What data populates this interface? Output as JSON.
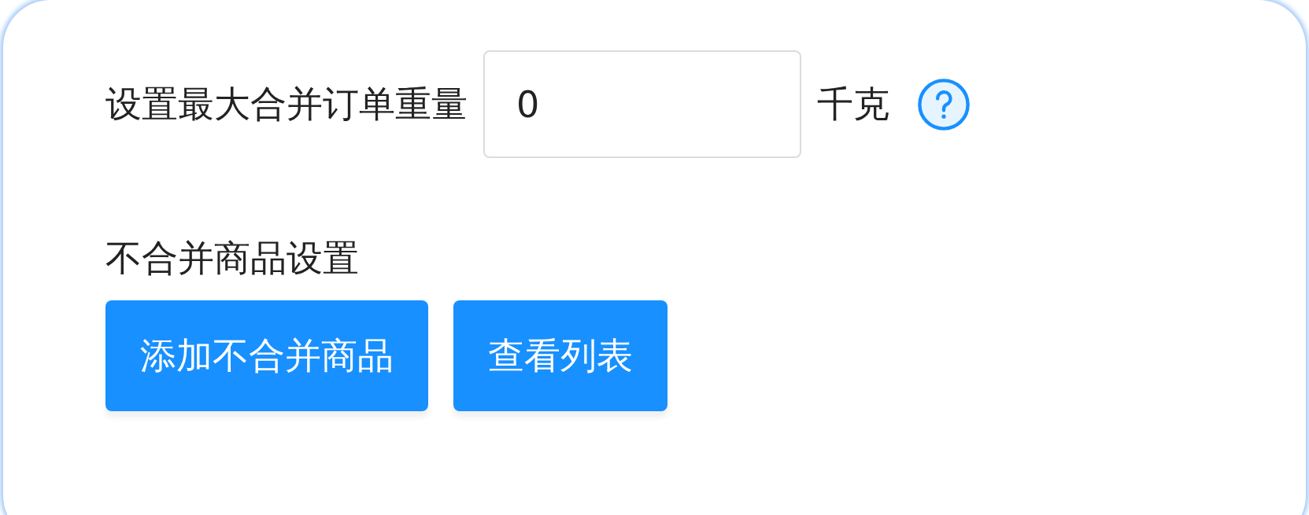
{
  "weight_setting": {
    "label": "设置最大合并订单重量",
    "value": "0",
    "unit": "千克"
  },
  "exclusion": {
    "title": "不合并商品设置",
    "buttons": [
      "添加不合并商品",
      "查看列表"
    ]
  }
}
